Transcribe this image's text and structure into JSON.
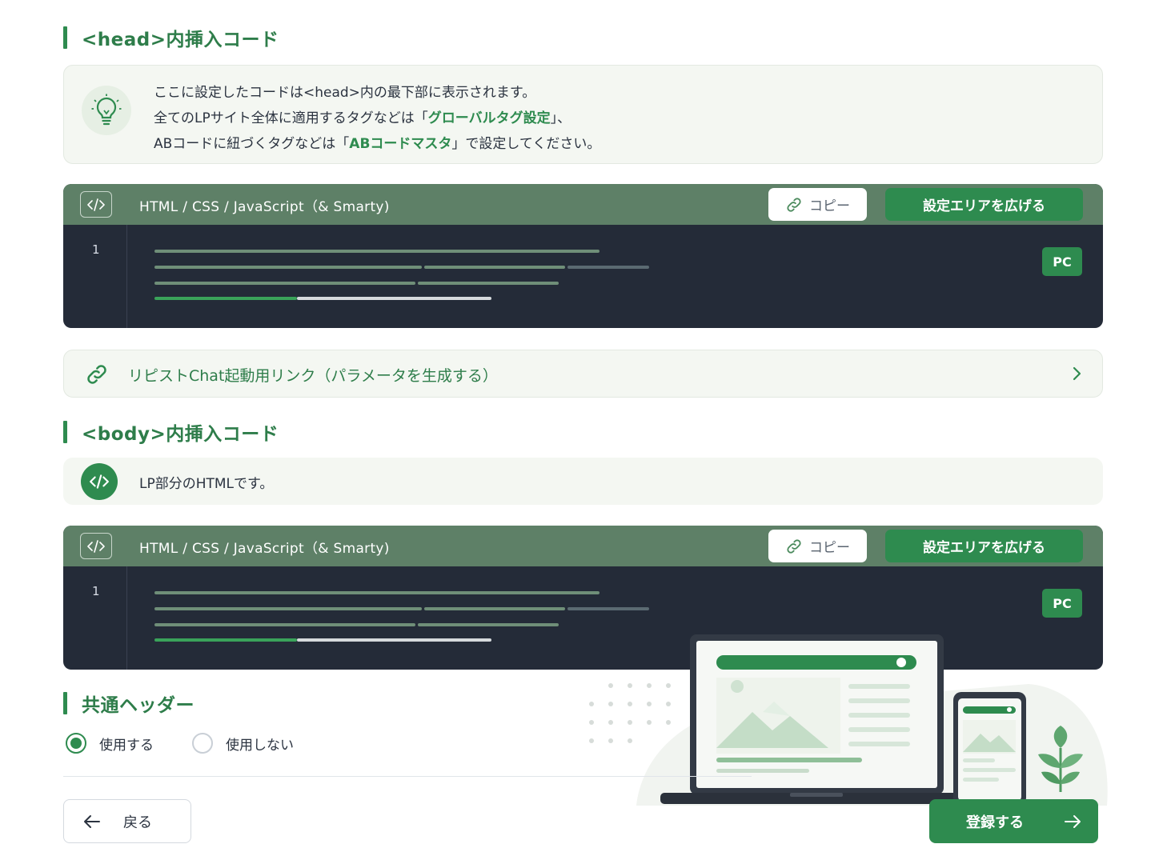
{
  "head_section": {
    "title": "<head>内挿入コード",
    "info": {
      "line1": "ここに設定したコードは<head>内の最下部に表示されます。",
      "line2_pre": "全てのLPサイト全体に適用するタグなどは「",
      "line2_link": "グローバルタグ設定",
      "line2_post": "」、",
      "line3_pre": "ABコードに紐づくタグなどは「",
      "line3_link": "ABコードマスタ",
      "line3_post": "」で設定してください。"
    },
    "editor": {
      "title": "HTML / CSS / JavaScript（& Smarty)",
      "copy_label": "コピー",
      "expand_label": "設定エリアを広げる",
      "line_number": "1",
      "badge": "PC"
    }
  },
  "chat_link": {
    "label": "リピストChat起動用リンク（パラメータを生成する）"
  },
  "body_section": {
    "title": "<body>内挿入コード",
    "info": "LP部分のHTMLです。",
    "editor": {
      "title": "HTML / CSS / JavaScript（& Smarty)",
      "copy_label": "コピー",
      "expand_label": "設定エリアを広げる",
      "line_number": "1",
      "badge": "PC"
    }
  },
  "common_header": {
    "title": "共通ヘッダー",
    "options": [
      {
        "label": "使用する",
        "selected": true
      },
      {
        "label": "使用しない",
        "selected": false
      }
    ]
  },
  "footer": {
    "back_label": "戻る",
    "submit_label": "登録する"
  },
  "colors": {
    "accent": "#2e8b4f",
    "editor_bg": "#242b38",
    "editor_header": "#5e8067",
    "panel_bg": "#f4f7f2"
  }
}
